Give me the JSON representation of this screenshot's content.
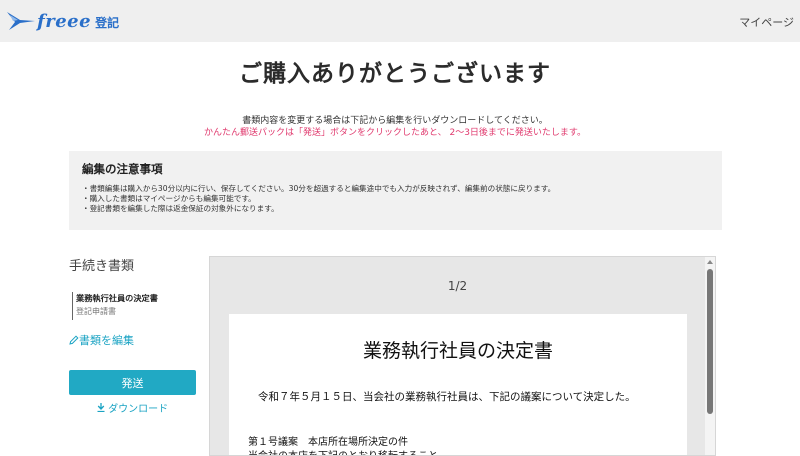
{
  "header": {
    "logo_text": "freee",
    "logo_sub": "登記",
    "mypage_label": "マイページ"
  },
  "main": {
    "title": "ご購入ありがとうございます",
    "subtitle": "書類内容を変更する場合は下記から編集を行いダウンロードしてください。",
    "alert": "かんたん郵送パックは「発送」ボタンをクリックしたあと、 2〜3日後までに発送いたします。"
  },
  "notice": {
    "title": "編集の注意事項",
    "items": [
      "・書類編集は購入から30分以内に行い、保存してください。30分を超過すると編集途中でも入力が反映されず、編集前の状態に戻ります。",
      "・購入した書類はマイページからも編集可能です。",
      "・登記書類を編集した際は返金保証の対象外になります。"
    ]
  },
  "sidebar": {
    "title": "手続き書類",
    "document_name": "業務執行社員の決定書",
    "document_type": "登記申請書",
    "edit_label": "書類を編集",
    "send_label": "発送",
    "download_label": "ダウンロード"
  },
  "viewer": {
    "page_indicator": "1/2",
    "doc_title": "業務執行社員の決定書",
    "line1": "令和７年５月１５日、当会社の業務執行社員は、下記の議案について決定した。",
    "line2": "第１号議案　本店所在場所決定の件",
    "line3": "当会社の本店を下記のとおり移転すること。"
  },
  "colors": {
    "brand": "#2a6fc9",
    "accent": "#21a9c4",
    "alert": "#e03a6e"
  },
  "icons": {
    "logo": "paper-plane-bird-icon",
    "edit": "pencil-icon",
    "download": "download-arrow-icon"
  }
}
